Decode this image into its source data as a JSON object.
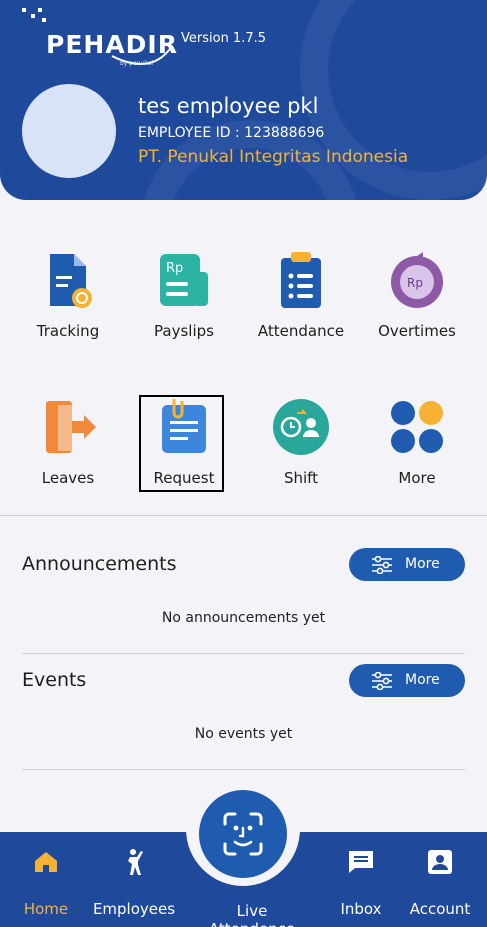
{
  "header": {
    "logo_text": "PEHADIR",
    "logo_sub": "by penukal",
    "version": "Version 1.7.5",
    "employee_name": "tes employee pkl",
    "employee_id": "EMPLOYEE ID : 123888696",
    "company": "PT. Penukal Integritas Indonesia"
  },
  "menu": {
    "row1": [
      {
        "label": "Tracking",
        "icon": "document-tracking-icon"
      },
      {
        "label": "Payslips",
        "icon": "payslip-icon"
      },
      {
        "label": "Attendance",
        "icon": "clipboard-list-icon"
      },
      {
        "label": "Overtimes",
        "icon": "overtime-clock-icon"
      }
    ],
    "row2": [
      {
        "label": "Leaves",
        "icon": "exit-door-icon"
      },
      {
        "label": "Request",
        "icon": "request-clip-icon"
      },
      {
        "label": "Shift",
        "icon": "shift-icon"
      },
      {
        "label": "More",
        "icon": "grid-dots-icon"
      }
    ]
  },
  "announcements": {
    "title": "Announcements",
    "more_label": "More",
    "empty_text": "No announcements yet"
  },
  "events": {
    "title": "Events",
    "more_label": "More",
    "empty_text": "No events yet"
  },
  "bottom_nav": {
    "home": "Home",
    "employees": "Employees",
    "live": "Live Attendence",
    "inbox": "Inbox",
    "account": "Account"
  },
  "colors": {
    "primary": "#1f4a9c",
    "accent": "#f6b233",
    "button": "#1f5cb0"
  }
}
